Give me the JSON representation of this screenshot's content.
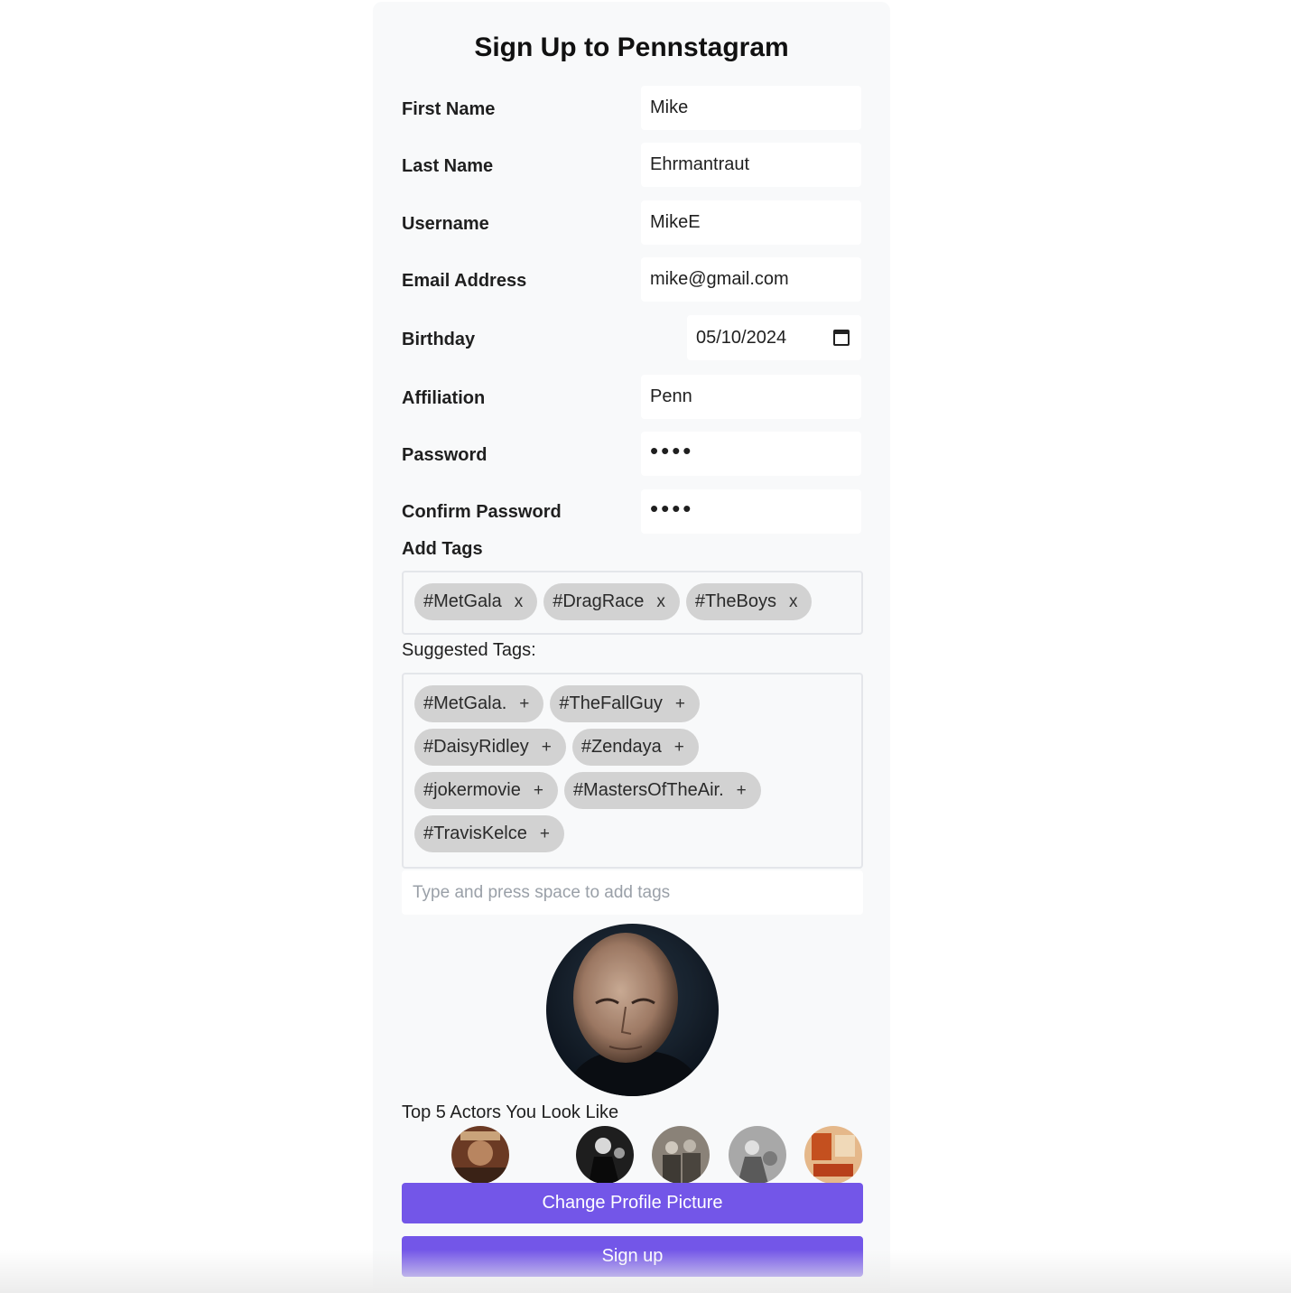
{
  "form": {
    "title": "Sign Up to Pennstagram",
    "fields": [
      {
        "label": "First Name",
        "value": "Mike"
      },
      {
        "label": "Last Name",
        "value": "Ehrmantraut"
      },
      {
        "label": "Username",
        "value": "MikeE"
      },
      {
        "label": "Email Address",
        "value": "mike@gmail.com"
      },
      {
        "label": "Birthday",
        "value": "05/10/2024"
      },
      {
        "label": "Affiliation",
        "value": "Penn"
      },
      {
        "label": "Password",
        "value": "••••"
      },
      {
        "label": "Confirm Password",
        "value": "••••"
      }
    ]
  },
  "tags": {
    "label": "Add Tags",
    "selected": [
      "#MetGala",
      "#DragRace",
      "#TheBoys"
    ],
    "remove_symbol": "x",
    "suggested_label": "Suggested Tags:",
    "suggested": [
      "#MetGala.",
      "#TheFallGuy",
      "#DaisyRidley",
      "#Zendaya",
      "#jokermovie",
      "#MastersOfTheAir.",
      "#TravisKelce"
    ],
    "add_symbol": "+",
    "input_placeholder": "Type and press space to add tags"
  },
  "actors": {
    "label": "Top 5 Actors You Look Like"
  },
  "buttons": {
    "change_picture": "Change Profile Picture",
    "sign_up": "Sign up"
  },
  "colors": {
    "accent": "#7356e8",
    "card_background": "#f8f9fa",
    "chip_background": "#d2d2d2"
  },
  "icons": {
    "birthday_picker": "calendar-icon"
  }
}
